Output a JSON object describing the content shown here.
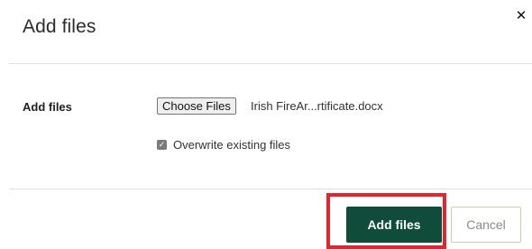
{
  "dialog": {
    "title": "Add files",
    "close_icon": "close-icon",
    "close_glyph": "✕"
  },
  "form": {
    "field_label": "Add files",
    "choose_button_label": "Choose Files",
    "selected_file_name": "Irish FireAr...rtificate.docx",
    "overwrite_checkbox": {
      "checked": true,
      "check_glyph": "✓",
      "label": "Overwrite existing files"
    }
  },
  "footer": {
    "primary_button_label": "Add files",
    "cancel_button_label": "Cancel"
  },
  "colors": {
    "primary": "#0f4d3a",
    "highlight": "#e4252d",
    "checkbox": "#7a7a7a"
  }
}
